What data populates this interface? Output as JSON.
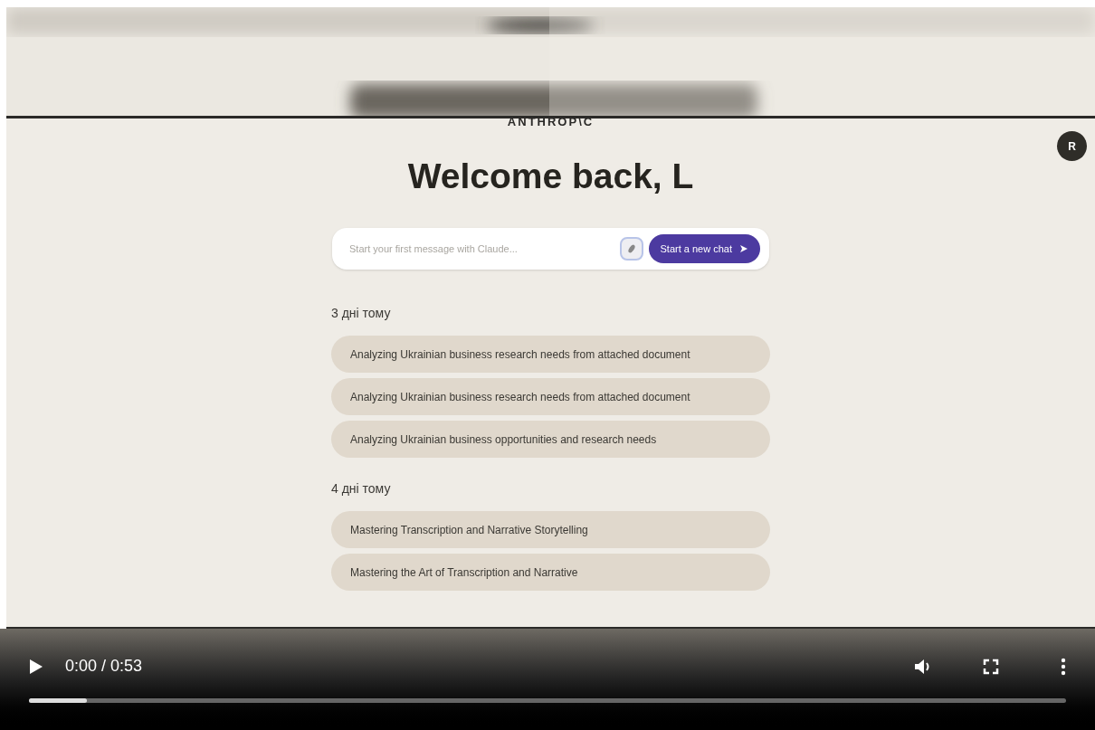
{
  "app": {
    "logo": "ANTHROP\\C",
    "avatar": "R",
    "heading": "Welcome back, L",
    "composer": {
      "placeholder": "Start your first message with Claude...",
      "button": "Start a new chat"
    },
    "groups": [
      {
        "label": "3 дні тому",
        "chats": [
          "Analyzing Ukrainian business research needs from attached document",
          "Analyzing Ukrainian business research needs from attached document",
          "Analyzing Ukrainian business opportunities and research needs"
        ]
      },
      {
        "label": "4 дні тому",
        "chats": [
          "Mastering Transcription and Narrative Storytelling",
          "Mastering the Art of Transcription and Narrative"
        ]
      }
    ]
  },
  "player": {
    "time": "0:00 / 0:53",
    "progress": {
      "level": 0.056
    }
  }
}
